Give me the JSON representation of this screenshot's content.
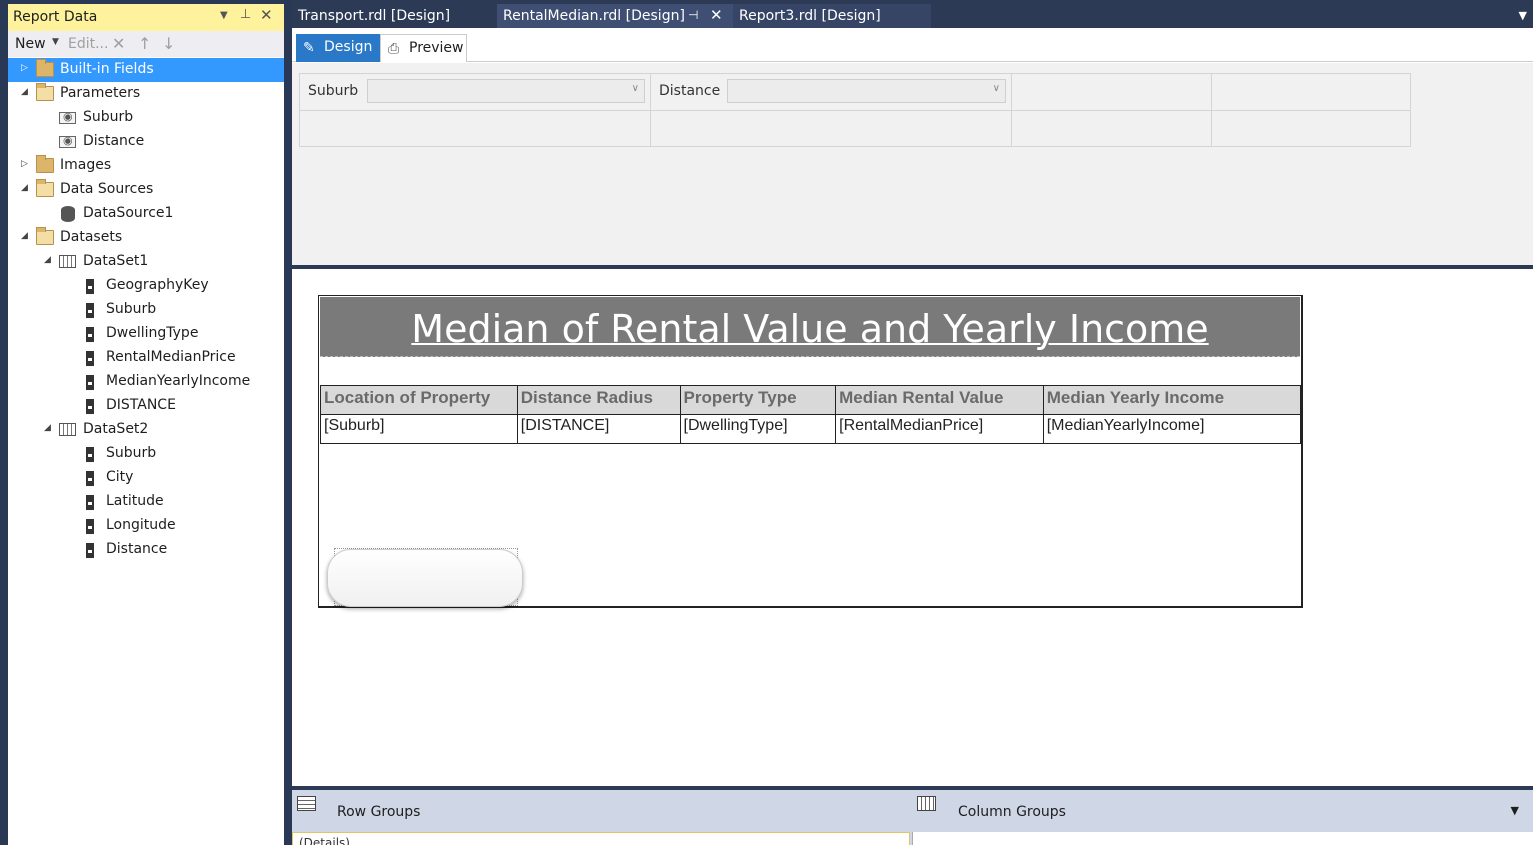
{
  "report_data_panel": {
    "title": "Report Data",
    "toolbar": {
      "new_label": "New",
      "edit_label": "Edit..."
    },
    "tree": {
      "built_in_fields": "Built-in Fields",
      "parameters": "Parameters",
      "param_suburb": "Suburb",
      "param_distance": "Distance",
      "images": "Images",
      "data_sources": "Data Sources",
      "datasource1": "DataSource1",
      "datasets": "Datasets",
      "dataset1": "DataSet1",
      "dataset1_fields": [
        "GeographyKey",
        "Suburb",
        "DwellingType",
        "RentalMedianPrice",
        "MedianYearlyIncome",
        "DISTANCE"
      ],
      "dataset2": "DataSet2",
      "dataset2_fields": [
        "Suburb",
        "City",
        "Latitude",
        "Longitude",
        "Distance"
      ]
    }
  },
  "doc_tabs": [
    "Transport.rdl [Design]",
    "RentalMedian.rdl [Design]",
    "Report3.rdl [Design]"
  ],
  "view_tabs": {
    "design": "Design",
    "preview": "Preview"
  },
  "parameters_area": {
    "suburb_label": "Suburb",
    "distance_label": "Distance"
  },
  "report": {
    "title": "Median of Rental Value and Yearly Income",
    "headers": [
      "Location of Property",
      "Distance Radius",
      "Property Type",
      "Median Rental Value",
      "Median Yearly Income"
    ],
    "row": [
      "[Suburb]",
      "[DISTANCE]",
      "[DwellingType]",
      "[RentalMedianPrice]",
      "[MedianYearlyIncome]"
    ]
  },
  "groups": {
    "row_groups": "Row Groups",
    "column_groups": "Column Groups",
    "details": "(Details)"
  },
  "colors": {
    "accent": "#3399ff",
    "design_tab": "#2979c8",
    "panel_header": "#fff29d",
    "chrome": "#2d3a55"
  }
}
